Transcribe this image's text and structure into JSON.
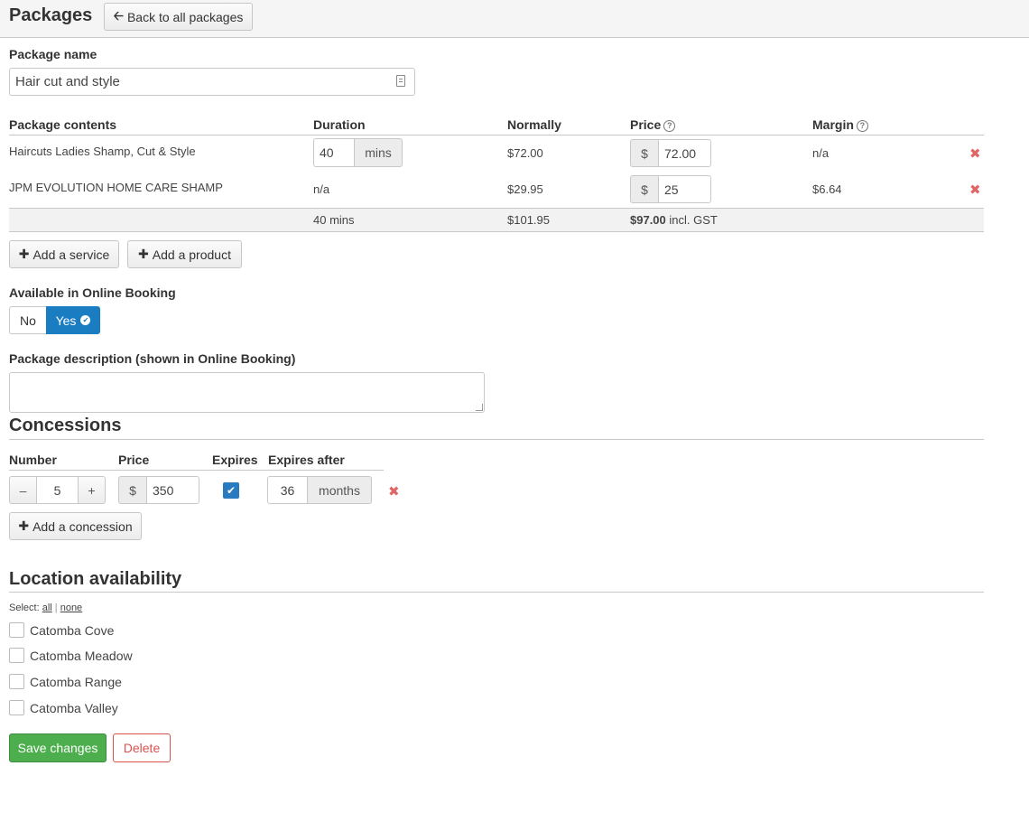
{
  "header": {
    "title": "Packages",
    "back_label": "Back to all packages",
    "back_icon": "arrow-left-icon"
  },
  "package_name": {
    "label": "Package name",
    "value": "Hair cut and style"
  },
  "contents": {
    "headers": {
      "contents": "Package contents",
      "duration": "Duration",
      "normally": "Normally",
      "price": "Price",
      "margin": "Margin"
    },
    "rows": [
      {
        "name": "Haircuts Ladies Shamp, Cut & Style",
        "duration_value": "40",
        "duration_unit": "mins",
        "normally": "$72.00",
        "currency": "$",
        "price": "72.00",
        "margin": "n/a"
      },
      {
        "name": "JPM EVOLUTION HOME CARE SHAMP",
        "duration": "n/a",
        "normally": "$29.95",
        "currency": "$",
        "price": "25",
        "margin": "$6.64"
      }
    ],
    "totals": {
      "duration": "40 mins",
      "normally": "$101.95",
      "price": "$97.00",
      "price_suffix": "incl. GST"
    },
    "add_service_label": "Add a service",
    "add_product_label": "Add a product"
  },
  "online_booking": {
    "label": "Available in Online Booking",
    "no_label": "No",
    "yes_label": "Yes",
    "selected": "Yes",
    "accent_color": "#1a7cc1"
  },
  "description": {
    "label": "Package description (shown in Online Booking)",
    "value": ""
  },
  "concessions": {
    "title": "Concessions",
    "headers": {
      "number": "Number",
      "price": "Price",
      "expires": "Expires",
      "expires_after": "Expires after"
    },
    "row": {
      "minus": "–",
      "number": "5",
      "plus": "+",
      "currency": "$",
      "price": "350",
      "expires_checked": true,
      "expires_after": "36",
      "unit": "months"
    },
    "add_label": "Add a concession"
  },
  "locations": {
    "title": "Location availability",
    "select_prefix": "Select:",
    "select_all": "all",
    "separator": "|",
    "select_none": "none",
    "items": [
      "Catomba Cove",
      "Catomba Meadow",
      "Catomba Range",
      "Catomba Valley"
    ]
  },
  "actions": {
    "save_label": "Save changes",
    "delete_label": "Delete",
    "save_color": "#4cae4c",
    "delete_color": "#d9534f"
  }
}
